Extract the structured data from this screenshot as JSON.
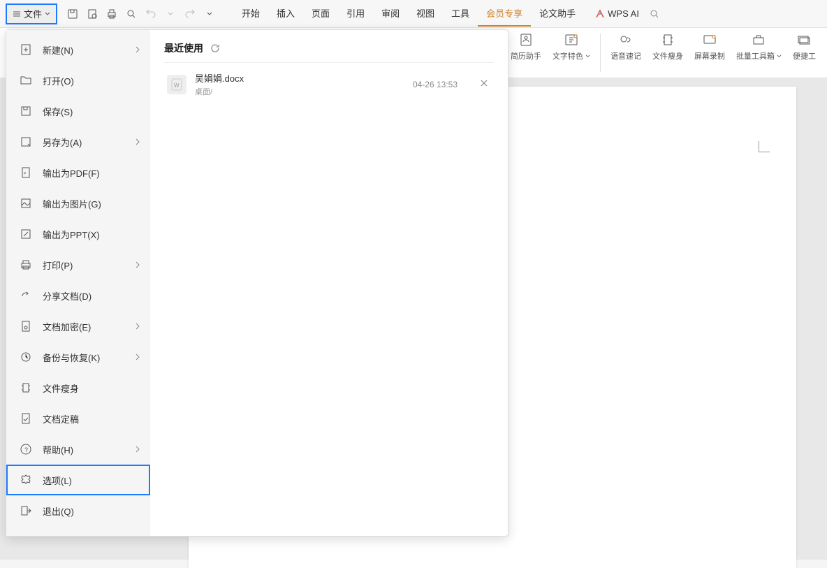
{
  "toolbar": {
    "file_label": "文件"
  },
  "tabs": {
    "start": "开始",
    "insert": "插入",
    "page": "页面",
    "reference": "引用",
    "review": "审阅",
    "view": "视图",
    "tools": "工具",
    "member": "会员专享",
    "thesis": "论文助手"
  },
  "ai": {
    "label": "WPS AI"
  },
  "ribbon": {
    "resume": "简历助手",
    "text_style": "文字特色",
    "voice": "语音速记",
    "slim": "文件瘦身",
    "screen": "屏幕录制",
    "batch": "批量工具箱",
    "shortcut": "便捷工"
  },
  "menu": {
    "new": "新建(N)",
    "open": "打开(O)",
    "save": "保存(S)",
    "saveas": "另存为(A)",
    "export_pdf": "输出为PDF(F)",
    "export_img": "输出为图片(G)",
    "export_ppt": "输出为PPT(X)",
    "print": "打印(P)",
    "share": "分享文档(D)",
    "encrypt": "文档加密(E)",
    "backup": "备份与恢复(K)",
    "slimfile": "文件瘦身",
    "finalize": "文档定稿",
    "help": "帮助(H)",
    "options": "选项(L)",
    "exit": "退出(Q)"
  },
  "recent": {
    "title": "最近使用",
    "items": [
      {
        "name": "吴娟娟.docx",
        "path": "桌面/",
        "time": "04-26 13:53"
      }
    ]
  }
}
